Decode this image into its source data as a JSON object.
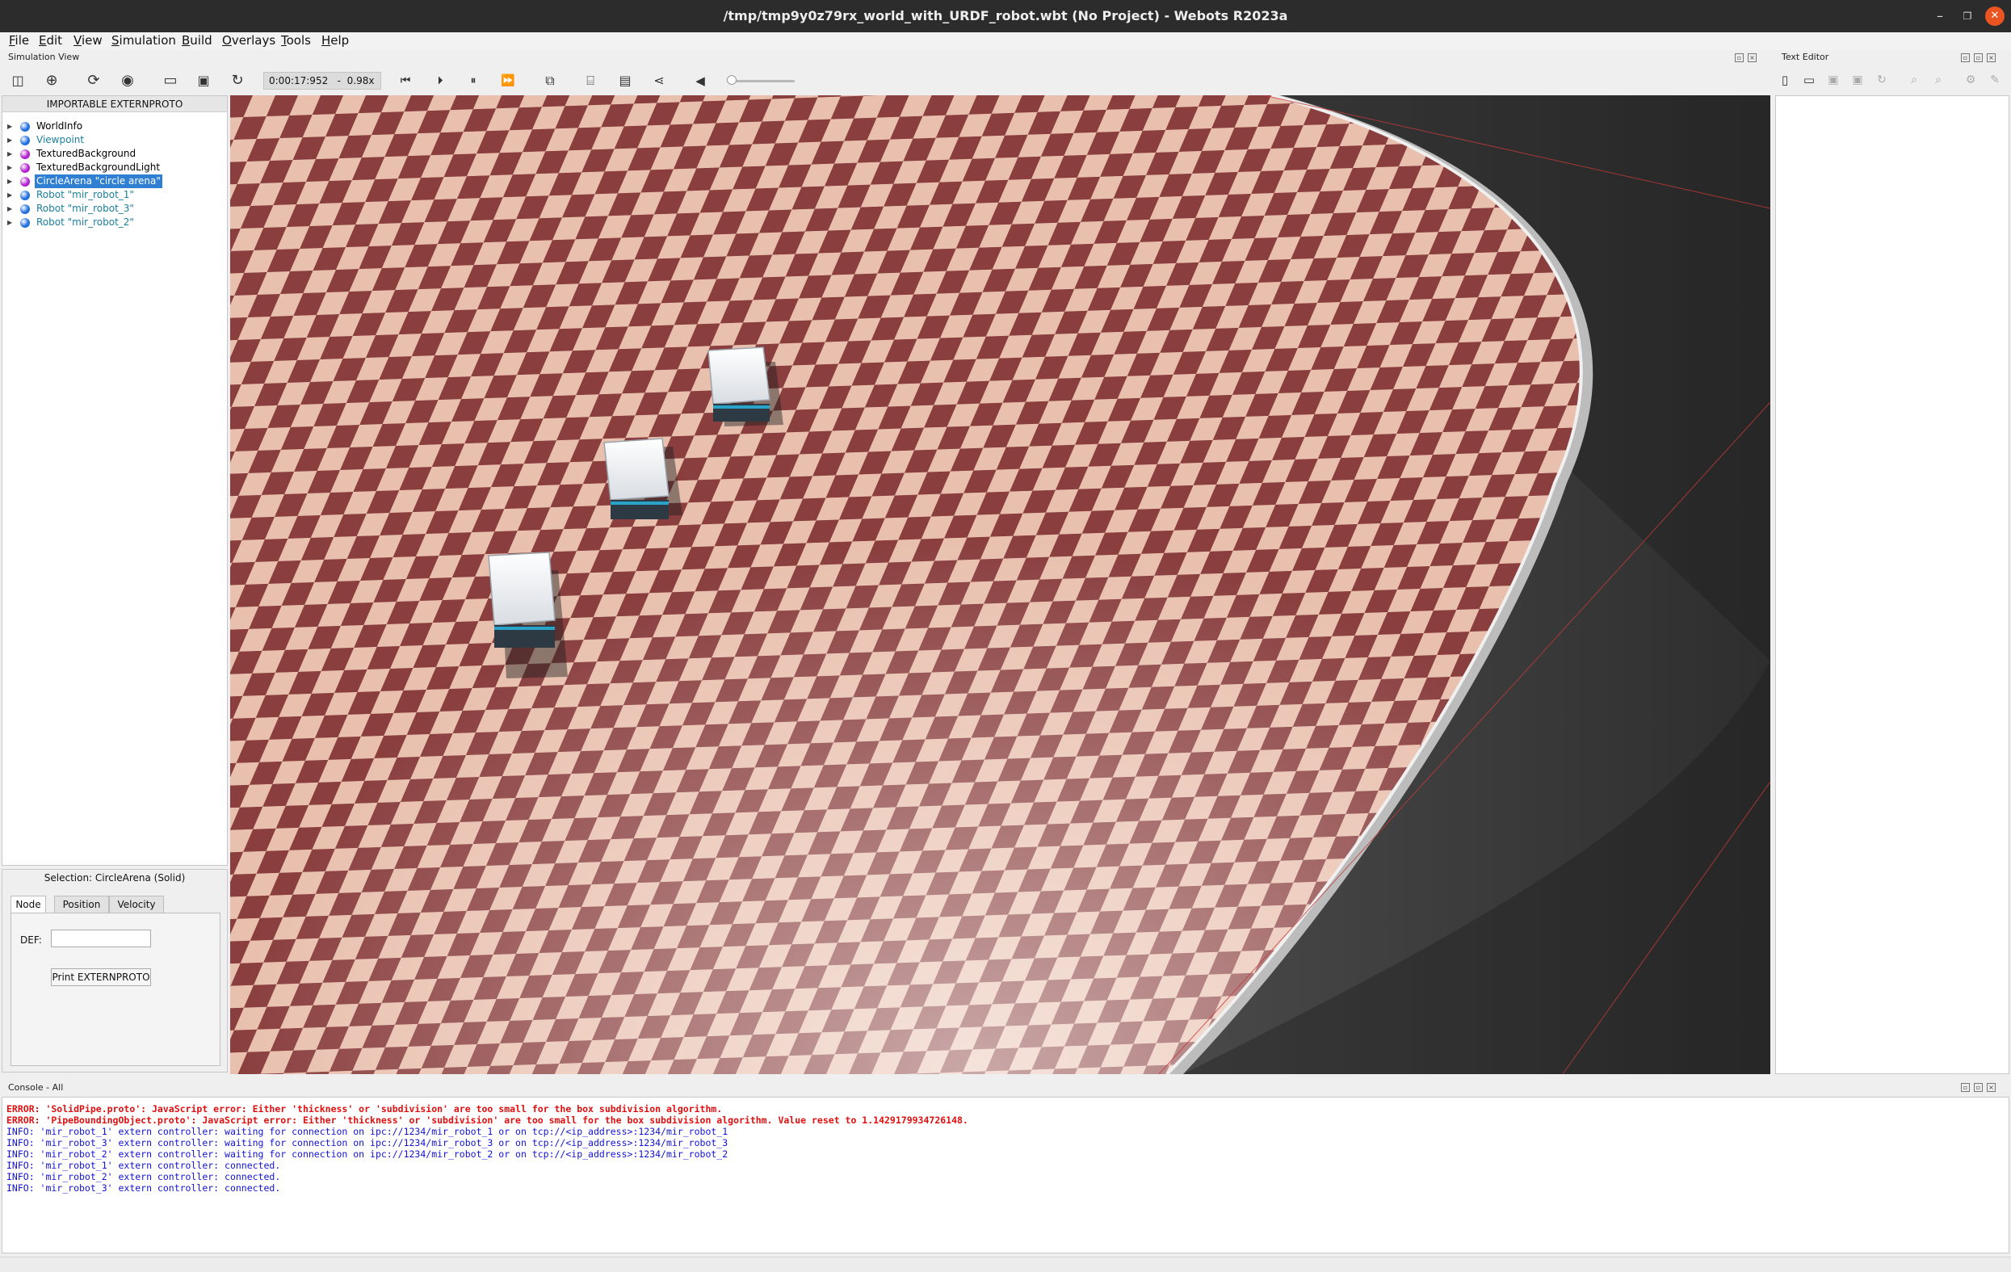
{
  "window": {
    "title": "/tmp/tmp9y0z79rx_world_with_URDF_robot.wbt (No Project) - Webots R2023a"
  },
  "menu": [
    "File",
    "Edit",
    "View",
    "Simulation",
    "Build",
    "Overlays",
    "Tools",
    "Help"
  ],
  "simulation_view": {
    "header": "Simulation View",
    "time": "0:00:17:952",
    "speed": "-  0.98x"
  },
  "scene_tree": {
    "header": "IMPORTABLE EXTERNPROTO",
    "items": [
      {
        "label": "WorldInfo",
        "color": "#1f6fe0"
      },
      {
        "label": "Viewpoint",
        "color": "#1f6fe0"
      },
      {
        "label": "TexturedBackground",
        "color": "#b21fd0"
      },
      {
        "label": "TexturedBackgroundLight",
        "color": "#b21fd0"
      },
      {
        "label": "CircleArena \"circle arena\"",
        "color": "#b21fd0"
      },
      {
        "label": "Robot \"mir_robot_1\"",
        "color": "#1f6fe0"
      },
      {
        "label": "Robot \"mir_robot_3\"",
        "color": "#1f6fe0"
      },
      {
        "label": "Robot \"mir_robot_2\"",
        "color": "#1f6fe0"
      }
    ]
  },
  "selection": {
    "title": "Selection: CircleArena (Solid)",
    "tabs": [
      "Node",
      "Position",
      "Velocity"
    ],
    "def_label": "DEF:",
    "def_value": "",
    "print_button": "Print EXTERNPROTO"
  },
  "text_editor": {
    "header": "Text Editor"
  },
  "console": {
    "header": "Console - All",
    "lines": [
      {
        "type": "error",
        "text": "ERROR: 'SolidPipe.proto': JavaScript error: Either 'thickness' or 'subdivision' are too small for the box subdivision algorithm."
      },
      {
        "type": "error",
        "text": "ERROR: 'PipeBoundingObject.proto': JavaScript error: Either 'thickness' or 'subdivision' are too small for the box subdivision algorithm. Value reset to 1.1429179934726148."
      },
      {
        "type": "info",
        "text": "INFO: 'mir_robot_1' extern controller: waiting for connection on ipc://1234/mir_robot_1 or on tcp://<ip_address>:1234/mir_robot_1"
      },
      {
        "type": "info",
        "text": "INFO: 'mir_robot_3' extern controller: waiting for connection on ipc://1234/mir_robot_3 or on tcp://<ip_address>:1234/mir_robot_3"
      },
      {
        "type": "info",
        "text": "INFO: 'mir_robot_2' extern controller: waiting for connection on ipc://1234/mir_robot_2 or on tcp://<ip_address>:1234/mir_robot_2"
      },
      {
        "type": "info",
        "text": "INFO: 'mir_robot_1' extern controller: connected."
      },
      {
        "type": "info",
        "text": "INFO: 'mir_robot_2' extern controller: connected."
      },
      {
        "type": "info",
        "text": "INFO: 'mir_robot_3' extern controller: connected."
      }
    ]
  },
  "colors": {
    "error": "#e01010",
    "info": "#1212d6",
    "selection": "#2f7fd3",
    "checker_dark": "#8a3e3e",
    "checker_light": "#e9c0ae"
  }
}
